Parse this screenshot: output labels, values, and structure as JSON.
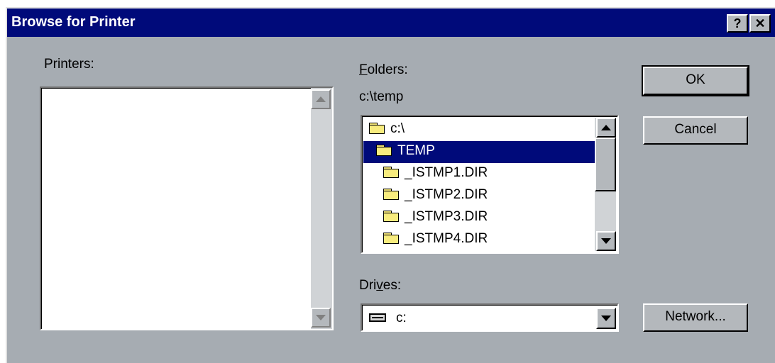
{
  "window": {
    "title": "Browse for Printer",
    "help_glyph": "?",
    "close_glyph": "✕"
  },
  "printers": {
    "label": "Printers:"
  },
  "folders": {
    "label_mnemonic": "F",
    "label_rest": "olders:",
    "current_path": "c:\\temp",
    "items": [
      {
        "label": "c:\\",
        "icon": "open-folder-icon",
        "selected": false
      },
      {
        "label": "TEMP",
        "icon": "open-folder-icon",
        "selected": true
      },
      {
        "label": "_ISTMP1.DIR",
        "icon": "folder-icon",
        "selected": false
      },
      {
        "label": "_ISTMP2.DIR",
        "icon": "folder-icon",
        "selected": false
      },
      {
        "label": "_ISTMP3.DIR",
        "icon": "folder-icon",
        "selected": false
      },
      {
        "label": "_ISTMP4.DIR",
        "icon": "folder-icon",
        "selected": false
      }
    ]
  },
  "drives": {
    "label_pre": "Dri",
    "label_mnemonic": "v",
    "label_post": "es:",
    "selected": "c:",
    "icon": "drive-icon"
  },
  "buttons": {
    "ok": "OK",
    "cancel": "Cancel",
    "network": "Network..."
  },
  "colors": {
    "face": "#a6acb2",
    "title_bar": "#000a7a",
    "selection": "#000a7a"
  }
}
